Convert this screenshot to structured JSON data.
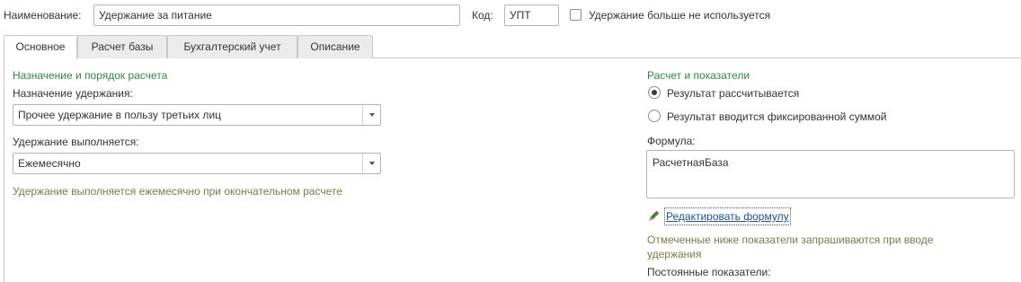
{
  "header": {
    "name_label": "Наименование:",
    "name_value": "Удержание за питание",
    "code_label": "Код:",
    "code_value": "УПТ",
    "not_used_label": "Удержание больше не используется"
  },
  "tabs": [
    {
      "label": "Основное"
    },
    {
      "label": "Расчет базы"
    },
    {
      "label": "Бухгалтерский учет"
    },
    {
      "label": "Описание"
    }
  ],
  "left": {
    "section_title": "Назначение и порядок расчета",
    "purpose_label": "Назначение удержания:",
    "purpose_value": "Прочее удержание в пользу третьих лиц",
    "schedule_label": "Удержание выполняется:",
    "schedule_value": "Ежемесячно",
    "schedule_note": "Удержание выполняется ежемесячно при окончательном расчете"
  },
  "right": {
    "section_title": "Расчет и показатели",
    "radio_calculated": "Результат рассчитывается",
    "radio_fixed": "Результат вводится фиксированной суммой",
    "formula_label": "Формула:",
    "formula_value": "РасчетнаяБаза",
    "edit_formula_link": "Редактировать формулу",
    "note": "Отмеченные ниже показатели запрашиваются при вводе удержания",
    "constant_indicators_label": "Постоянные показатели:"
  },
  "icons": {
    "pencil": "pencil-icon",
    "dropdown": "chevron-down-icon"
  },
  "colors": {
    "section_title": "#2e8b3e",
    "note": "#7a7a4a",
    "link": "#1a4f9c"
  }
}
